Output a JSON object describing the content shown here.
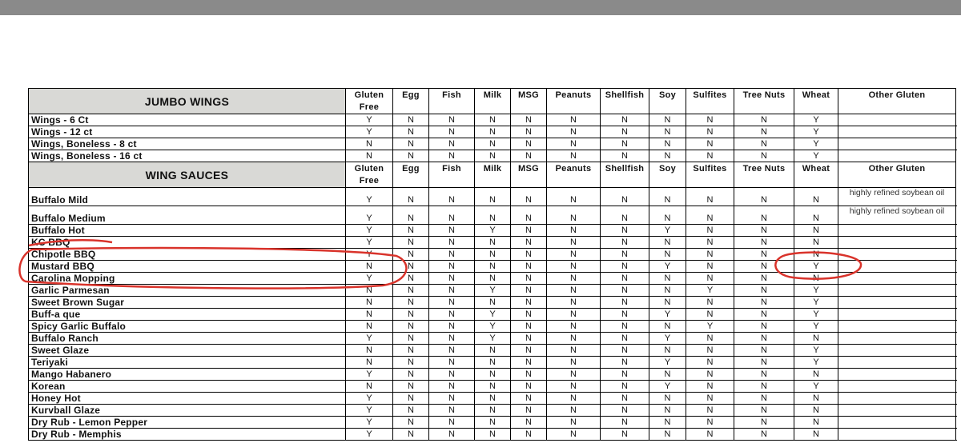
{
  "columns": [
    "Gluten Free",
    "Egg",
    "Fish",
    "Milk",
    "MSG",
    "Peanuts",
    "Shellfish",
    "Soy",
    "Sulfites",
    "Tree Nuts",
    "Wheat",
    "Other Gluten"
  ],
  "sections": [
    {
      "title": "JUMBO WINGS",
      "rows": [
        {
          "name": "Wings - 6 Ct",
          "values": [
            "Y",
            "N",
            "N",
            "N",
            "N",
            "N",
            "N",
            "N",
            "N",
            "N",
            "Y",
            ""
          ]
        },
        {
          "name": "Wings - 12  ct",
          "values": [
            "Y",
            "N",
            "N",
            "N",
            "N",
            "N",
            "N",
            "N",
            "N",
            "N",
            "Y",
            ""
          ]
        },
        {
          "name": "Wings, Boneless - 8 ct",
          "values": [
            "N",
            "N",
            "N",
            "N",
            "N",
            "N",
            "N",
            "N",
            "N",
            "N",
            "Y",
            ""
          ]
        },
        {
          "name": "Wings, Boneless - 16 ct",
          "values": [
            "N",
            "N",
            "N",
            "N",
            "N",
            "N",
            "N",
            "N",
            "N",
            "N",
            "Y",
            ""
          ]
        }
      ]
    },
    {
      "title": "WING SAUCES",
      "rows": [
        {
          "name": "Buffalo Mild",
          "values": [
            "Y",
            "N",
            "N",
            "N",
            "N",
            "N",
            "N",
            "N",
            "N",
            "N",
            "N",
            "highly refined soybean oil"
          ]
        },
        {
          "name": "Buffalo Medium",
          "values": [
            "Y",
            "N",
            "N",
            "N",
            "N",
            "N",
            "N",
            "N",
            "N",
            "N",
            "N",
            "highly refined soybean oil"
          ]
        },
        {
          "name": "Buffalo Hot",
          "values": [
            "Y",
            "N",
            "N",
            "Y",
            "N",
            "N",
            "N",
            "Y",
            "N",
            "N",
            "N",
            ""
          ]
        },
        {
          "name": "KC BBQ",
          "values": [
            "Y",
            "N",
            "N",
            "N",
            "N",
            "N",
            "N",
            "N",
            "N",
            "N",
            "N",
            ""
          ]
        },
        {
          "name": "Chipotle BBQ",
          "values": [
            "Y",
            "N",
            "N",
            "N",
            "N",
            "N",
            "N",
            "N",
            "N",
            "N",
            "N",
            ""
          ]
        },
        {
          "name": "Mustard BBQ",
          "values": [
            "N",
            "N",
            "N",
            "N",
            "N",
            "N",
            "N",
            "Y",
            "N",
            "N",
            "Y",
            ""
          ]
        },
        {
          "name": "Carolina Mopping",
          "values": [
            "Y",
            "N",
            "N",
            "N",
            "N",
            "N",
            "N",
            "N",
            "N",
            "N",
            "N",
            ""
          ]
        },
        {
          "name": "Garlic Parmesan",
          "values": [
            "N",
            "N",
            "N",
            "Y",
            "N",
            "N",
            "N",
            "N",
            "Y",
            "N",
            "Y",
            ""
          ]
        },
        {
          "name": "Sweet Brown Sugar",
          "values": [
            "N",
            "N",
            "N",
            "N",
            "N",
            "N",
            "N",
            "N",
            "N",
            "N",
            "Y",
            ""
          ]
        },
        {
          "name": "Buff-a que",
          "values": [
            "N",
            "N",
            "N",
            "Y",
            "N",
            "N",
            "N",
            "Y",
            "N",
            "N",
            "Y",
            ""
          ]
        },
        {
          "name": "Spicy Garlic Buffalo",
          "values": [
            "N",
            "N",
            "N",
            "Y",
            "N",
            "N",
            "N",
            "N",
            "Y",
            "N",
            "Y",
            ""
          ]
        },
        {
          "name": "Buffalo Ranch",
          "values": [
            "Y",
            "N",
            "N",
            "Y",
            "N",
            "N",
            "N",
            "Y",
            "N",
            "N",
            "N",
            ""
          ]
        },
        {
          "name": "Sweet Glaze",
          "values": [
            "N",
            "N",
            "N",
            "N",
            "N",
            "N",
            "N",
            "N",
            "N",
            "N",
            "Y",
            ""
          ]
        },
        {
          "name": "Teriyaki",
          "values": [
            "N",
            "N",
            "N",
            "N",
            "N",
            "N",
            "N",
            "Y",
            "N",
            "N",
            "Y",
            ""
          ]
        },
        {
          "name": "Mango Habanero",
          "values": [
            "Y",
            "N",
            "N",
            "N",
            "N",
            "N",
            "N",
            "N",
            "N",
            "N",
            "N",
            ""
          ]
        },
        {
          "name": "Korean",
          "values": [
            "N",
            "N",
            "N",
            "N",
            "N",
            "N",
            "N",
            "Y",
            "N",
            "N",
            "Y",
            ""
          ]
        },
        {
          "name": "Honey Hot",
          "values": [
            "Y",
            "N",
            "N",
            "N",
            "N",
            "N",
            "N",
            "N",
            "N",
            "N",
            "N",
            ""
          ]
        },
        {
          "name": "Kurvball Glaze",
          "values": [
            "Y",
            "N",
            "N",
            "N",
            "N",
            "N",
            "N",
            "N",
            "N",
            "N",
            "N",
            ""
          ]
        },
        {
          "name": "Dry Rub - Lemon Pepper",
          "values": [
            "Y",
            "N",
            "N",
            "N",
            "N",
            "N",
            "N",
            "N",
            "N",
            "N",
            "N",
            ""
          ]
        },
        {
          "name": "Dry Rub - Memphis",
          "values": [
            "Y",
            "N",
            "N",
            "N",
            "N",
            "N",
            "N",
            "N",
            "N",
            "N",
            "N",
            ""
          ]
        }
      ]
    }
  ],
  "annotation_color": "#d9332b"
}
